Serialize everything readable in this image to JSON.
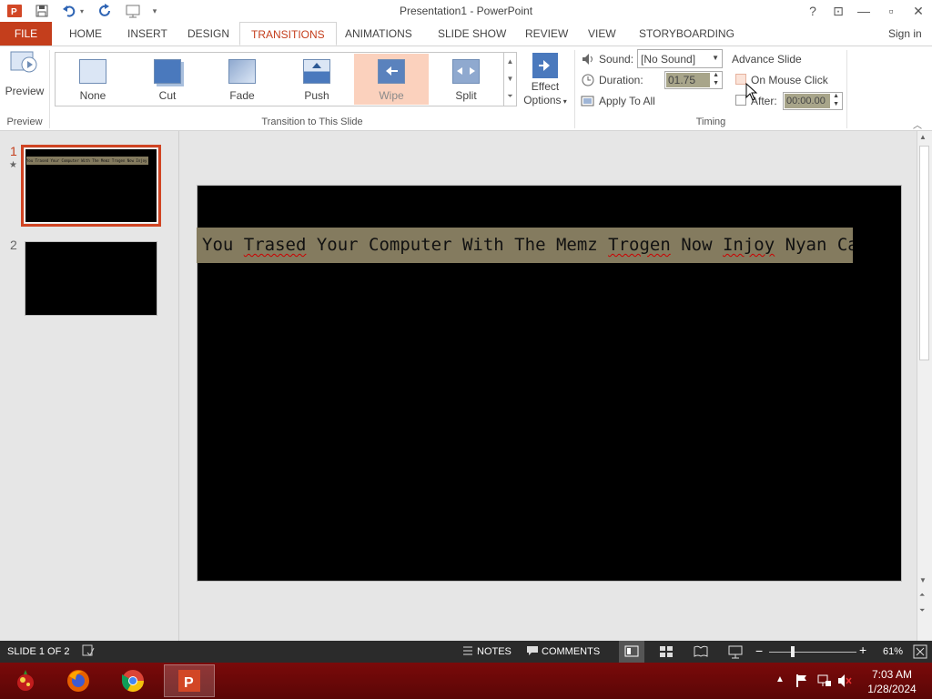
{
  "window": {
    "title": "Presentation1 - PowerPoint",
    "sign_in": "Sign in",
    "help": "?",
    "controls": {
      "restore_ribbon": "⊡",
      "minimize": "—",
      "maximize": "▫",
      "close": "✕"
    }
  },
  "quick_access": {
    "customize": "▾"
  },
  "tabs": [
    {
      "label": "FILE"
    },
    {
      "label": "HOME"
    },
    {
      "label": "INSERT"
    },
    {
      "label": "DESIGN"
    },
    {
      "label": "TRANSITIONS"
    },
    {
      "label": "ANIMATIONS"
    },
    {
      "label": "SLIDE SHOW"
    },
    {
      "label": "REVIEW"
    },
    {
      "label": "VIEW"
    },
    {
      "label": "STORYBOARDING"
    }
  ],
  "ribbon": {
    "preview": {
      "button_label": "Preview",
      "group_label": "Preview"
    },
    "transitions": {
      "items": [
        {
          "label": "None"
        },
        {
          "label": "Cut"
        },
        {
          "label": "Fade"
        },
        {
          "label": "Push"
        },
        {
          "label": "Wipe"
        },
        {
          "label": "Split"
        }
      ],
      "selected": "Wipe",
      "group_label": "Transition to This Slide"
    },
    "effect_options": {
      "line1": "Effect",
      "line2": "Options"
    },
    "timing": {
      "sound_label": "Sound:",
      "sound_value": "[No Sound]",
      "duration_label": "Duration:",
      "duration_value": "01.75",
      "apply_to_all": "Apply To All",
      "advance_slide": "Advance Slide",
      "on_mouse_click": "On Mouse Click",
      "on_mouse_click_checked": false,
      "after_label": "After:",
      "after_value": "00:00.00",
      "after_checked": false,
      "group_label": "Timing"
    }
  },
  "slides_panel": {
    "slides": [
      {
        "number": "1",
        "star": "★",
        "thumb_text": "You Trased Your Computer With The Memz Trogen Now Injoy Nyan Cat."
      },
      {
        "number": "2"
      }
    ]
  },
  "slide": {
    "text_parts": [
      "You ",
      "Trased",
      " Your Computer With The Memz ",
      "Trogen",
      " Now ",
      "Injoy",
      " Nyan Cat."
    ]
  },
  "status_bar": {
    "slide_info": "SLIDE 1 OF 2",
    "notes": "NOTES",
    "comments": "COMMENTS",
    "zoom": "61%",
    "zoom_level": 0.61
  },
  "taskbar": {
    "time": "7:03 AM",
    "date": "1/28/2024"
  },
  "colors": {
    "accent": "#c43e1c",
    "selected_transition": "#fbd1bd",
    "status_bar": "#2b2b2b",
    "taskbar": "#6a0808",
    "slide_text_bg": "#847b5f"
  }
}
